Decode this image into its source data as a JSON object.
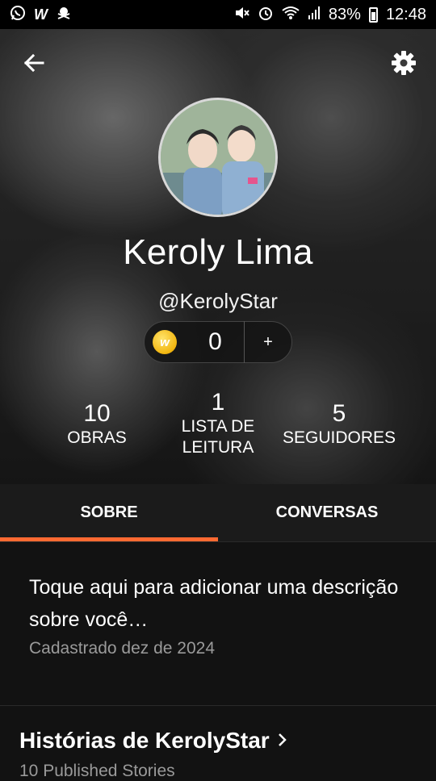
{
  "status_bar": {
    "battery": "83%",
    "time": "12:48",
    "left_icons": [
      "whatsapp-icon",
      "wattpad-icon",
      "pirate-icon"
    ],
    "right_icons": [
      "mute-icon",
      "alarm-icon",
      "wifi-icon",
      "signal-icon",
      "battery-icon"
    ]
  },
  "profile": {
    "name": "Keroly Lima",
    "username": "@KerolyStar",
    "coins": "0",
    "coins_add": "+"
  },
  "stats": {
    "works_count": "10",
    "works_label": "OBRAS",
    "reading_count": "1",
    "reading_label_line1": "LISTA DE",
    "reading_label_line2": "LEITURA",
    "followers_count": "5",
    "followers_label": "SEGUIDORES"
  },
  "tabs": [
    {
      "label": "SOBRE",
      "active": true
    },
    {
      "label": "CONVERSAS",
      "active": false
    }
  ],
  "about": {
    "description": "Toque aqui para adicionar uma descrição sobre você…",
    "joined": "Cadastrado dez de 2024"
  },
  "stories": {
    "title": "Histórias de KerolyStar",
    "subtitle": "10 Published Stories"
  },
  "colors": {
    "accent": "#ff6a32",
    "background": "#121212",
    "tab_bar": "#1b1b1b",
    "muted_text": "#9a9a9a"
  }
}
